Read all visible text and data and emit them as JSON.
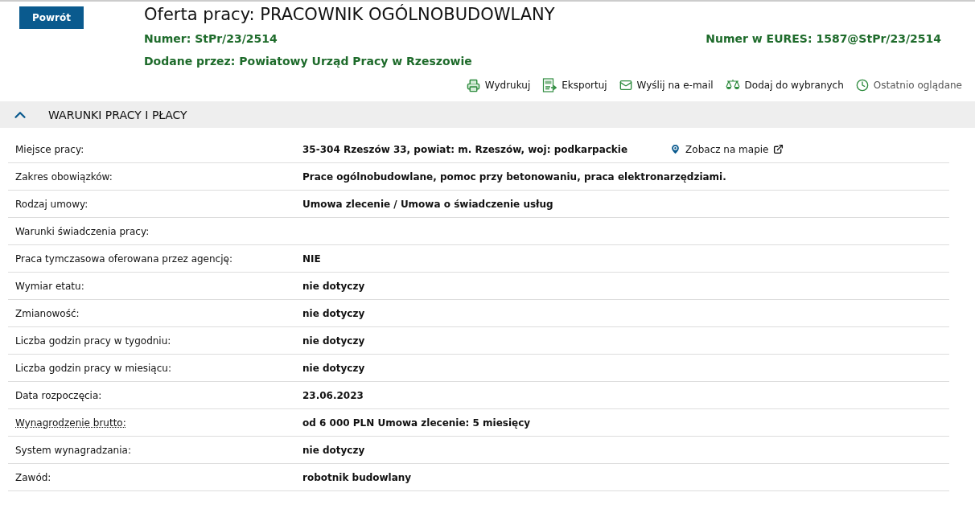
{
  "back_button": "Powrót",
  "title": "Oferta pracy: PRACOWNIK OGÓLNOBUDOWLANY",
  "meta": [
    {
      "label": "Numer:",
      "value": "StPr/23/2514"
    },
    {
      "label": "Numer w EURES:",
      "value": "1587@StPr/23/2514"
    },
    {
      "label": "Dodane przez:",
      "value": "Powiatowy Urząd Pracy w Rzeszowie"
    }
  ],
  "actions": [
    {
      "kind": "print",
      "label": "Wydrukuj",
      "disabled": false
    },
    {
      "kind": "pdf",
      "label": "Eksportuj",
      "disabled": false
    },
    {
      "kind": "mail",
      "label": "Wyślij na e-mail",
      "disabled": false
    },
    {
      "kind": "scales",
      "label": "Dodaj do wybranych",
      "disabled": false
    },
    {
      "kind": "clock",
      "label": "Ostatnio oglądane",
      "disabled": true
    }
  ],
  "section": {
    "title": "WARUNKI PRACY I PŁACY",
    "expanded": true,
    "rows": [
      {
        "label": "Miejsce pracy:",
        "value": "35-304 Rzeszów 33, powiat: m. Rzeszów, woj: podkarpackie",
        "link": "Zobacz na mapie"
      },
      {
        "label": "Zakres obowiązków:",
        "value": "Prace ogólnobudowlane, pomoc przy betonowaniu, praca elektronarzędziami."
      },
      {
        "label": "Rodzaj umowy:",
        "value": "Umowa zlecenie / Umowa o świadczenie usług"
      },
      {
        "label": "Warunki świadczenia pracy:"
      },
      {
        "label": "Praca tymczasowa oferowana przez agencję:",
        "value": "NIE"
      },
      {
        "label": "Wymiar etatu:",
        "value": "nie dotyczy"
      },
      {
        "label": "Zmianowość:",
        "value": "nie dotyczy"
      },
      {
        "label": "Liczba godzin pracy w tygodniu:",
        "value": "nie dotyczy"
      },
      {
        "label": "Liczba godzin pracy w miesiącu:",
        "value": "nie dotyczy"
      },
      {
        "label": "Data rozpoczęcia:",
        "value": "23.06.2023"
      },
      {
        "label": "Wynagrodzenie brutto:",
        "value": "od 6 000 PLN Umowa zlecenie: 5 miesięcy",
        "hint": true
      },
      {
        "label": "System wynagradzania:",
        "value": "nie dotyczy"
      },
      {
        "label": "Zawód:",
        "value": "robotnik budowlany"
      }
    ]
  }
}
